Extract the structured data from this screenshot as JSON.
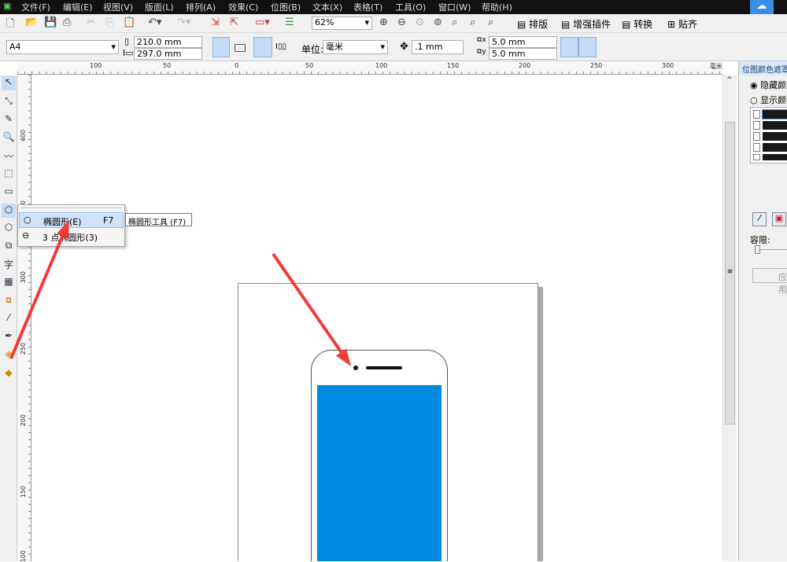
{
  "menu": [
    "文件(F)",
    "编辑(E)",
    "视图(V)",
    "版面(L)",
    "排列(A)",
    "效果(C)",
    "位图(B)",
    "文本(X)",
    "表格(T)",
    "工具(O)",
    "窗口(W)",
    "帮助(H)"
  ],
  "toolbar": {
    "zoom": "62%",
    "buttons": [
      "排版",
      "增强插件",
      "转换",
      "贴齐"
    ]
  },
  "propbar": {
    "page_size": "A4",
    "width": "210.0 mm",
    "height": "297.0 mm",
    "unit_label": "单位:",
    "unit": "毫米",
    "nudge": ".1 mm",
    "dup_x": "5.0 mm",
    "dup_y": "5.0 mm"
  },
  "ruler": {
    "top": [
      "100",
      "50",
      "0",
      "50",
      "100",
      "150",
      "200",
      "250",
      "300"
    ],
    "top_unit": "毫米",
    "left": [
      "400",
      "350",
      "300",
      "250",
      "200",
      "150",
      "100"
    ]
  },
  "flyout": {
    "items": [
      {
        "label": "椭圆形(E)",
        "shortcut": "F7"
      },
      {
        "label": "3 点椭圆形(3)",
        "shortcut": ""
      }
    ],
    "tooltip": "椭圆形工具 (F7)"
  },
  "docker": {
    "title": "位图颜色遮罩",
    "hide": "隐藏颜色",
    "show": "显示颜色",
    "tolerance": "容限:",
    "apply": "应用"
  },
  "colors": {
    "screen": "#0089e0",
    "arrow": "#f23a36"
  }
}
